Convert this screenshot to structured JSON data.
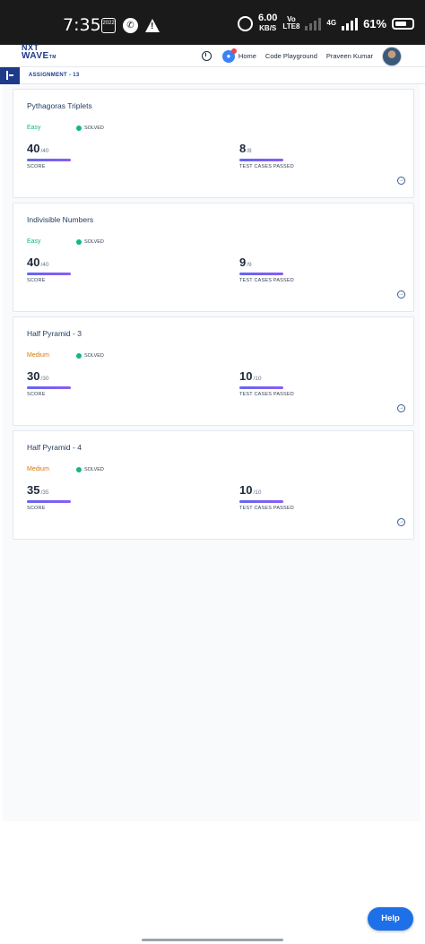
{
  "status_bar": {
    "time": "7:35",
    "calendar_text": "2022",
    "net_speed": "6.00",
    "net_speed_unit": "KB/S",
    "volte_top": "Vo",
    "volte_bottom": "LTE8",
    "network_type": "4G",
    "battery_percent": "61%"
  },
  "app": {
    "logo_line1": "NXT",
    "logo_line2": "WAVE",
    "logo_tm": "TM",
    "nav": {
      "home": "Home",
      "code_playground": "Code Playground",
      "user_name": "Praveen Kumar"
    },
    "breadcrumb": "ASSIGNMENT - 13"
  },
  "labels": {
    "solved": "SOLVED",
    "score": "SCORE",
    "test_cases": "TEST CASES PASSED"
  },
  "problems": [
    {
      "title": "Pythagoras Triplets",
      "difficulty": "Easy",
      "status": "SOLVED",
      "score": "40",
      "score_max": "/40",
      "tests": "8",
      "tests_max": "/8"
    },
    {
      "title": "Indivisible Numbers",
      "difficulty": "Easy",
      "status": "SOLVED",
      "score": "40",
      "score_max": "/40",
      "tests": "9",
      "tests_max": "/9"
    },
    {
      "title": "Half Pyramid - 3",
      "difficulty": "Medium",
      "status": "SOLVED",
      "score": "30",
      "score_max": "/30",
      "tests": "10",
      "tests_max": "/10"
    },
    {
      "title": "Half Pyramid - 4",
      "difficulty": "Medium",
      "status": "SOLVED",
      "score": "35",
      "score_max": "/35",
      "tests": "10",
      "tests_max": "/10"
    }
  ],
  "help_label": "Help",
  "colors": {
    "brand": "#1e3a8a",
    "easy": "#10b981",
    "medium": "#d97706",
    "help": "#1d70e8"
  }
}
